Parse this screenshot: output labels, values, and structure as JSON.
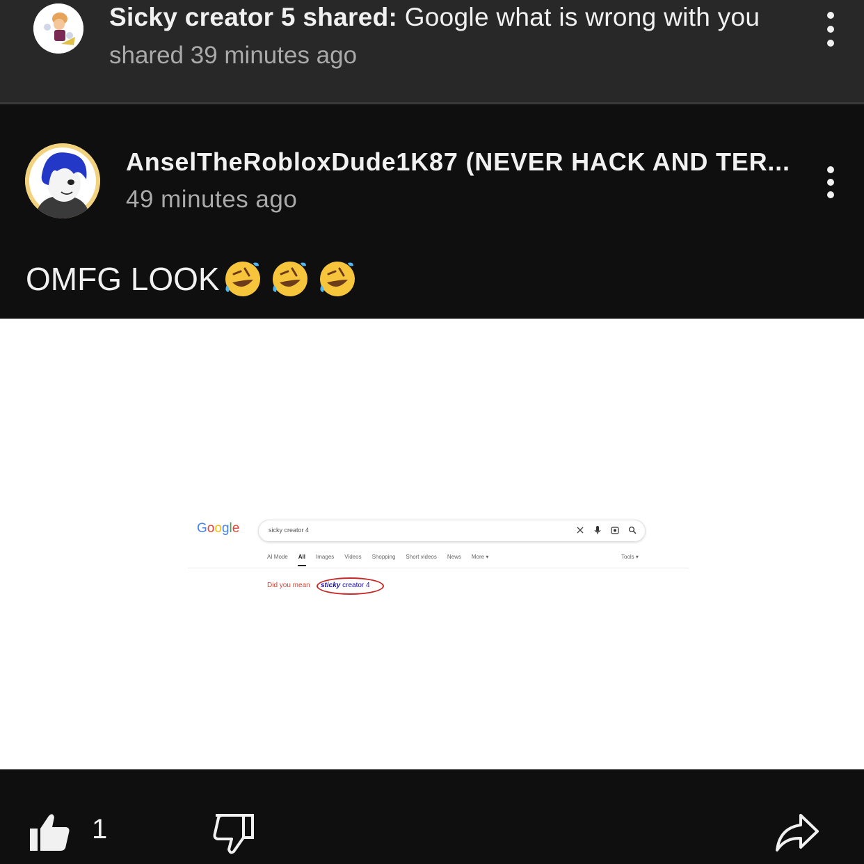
{
  "share_header": {
    "author": "Sicky creator 5 shared:",
    "title": "Google what is wrong with you",
    "time": "shared 39 minutes ago"
  },
  "post": {
    "author": "AnselTheRobloxDude1K87 (NEVER HACK AND TER...",
    "time": "49 minutes ago",
    "text": "OMFG LOOK",
    "emoji": "rolling-on-floor-laughing",
    "emoji_count": 3
  },
  "screenshot": {
    "logo": [
      "G",
      "o",
      "o",
      "g",
      "l",
      "e"
    ],
    "logo_colors": [
      "#4285f4",
      "#ea4335",
      "#fbbc05",
      "#4285f4",
      "#34a853",
      "#ea4335"
    ],
    "query": "sicky creator 4",
    "tabs": [
      "AI Mode",
      "All",
      "Images",
      "Videos",
      "Shopping",
      "Short videos",
      "News",
      "More ▾"
    ],
    "tools": "Tools ▾",
    "did_you_mean": "Did you mean",
    "suggestion_bold": "sticky",
    "suggestion_rest": " creator 4",
    "highlight_color": "#c62828"
  },
  "actions": {
    "like_count": "1"
  },
  "colors": {
    "background": "#0f0f0f",
    "header_bg": "#282828",
    "text": "#f1f1f1",
    "muted": "#aaaaaa"
  }
}
